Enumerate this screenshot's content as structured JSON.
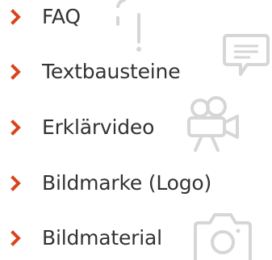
{
  "menu": {
    "items": [
      {
        "label": "FAQ",
        "icon": "question-mark-icon"
      },
      {
        "label": "Textbausteine",
        "icon": "speech-bubble-icon"
      },
      {
        "label": "Erklärvideo",
        "icon": "video-camera-icon"
      },
      {
        "label": "Bildmarke (Logo)",
        "icon": ""
      },
      {
        "label": "Bildmaterial",
        "icon": "photo-camera-icon"
      }
    ]
  },
  "colors": {
    "bullet": "#d9441b",
    "text": "#333333",
    "icon": "#d6d6d6"
  }
}
